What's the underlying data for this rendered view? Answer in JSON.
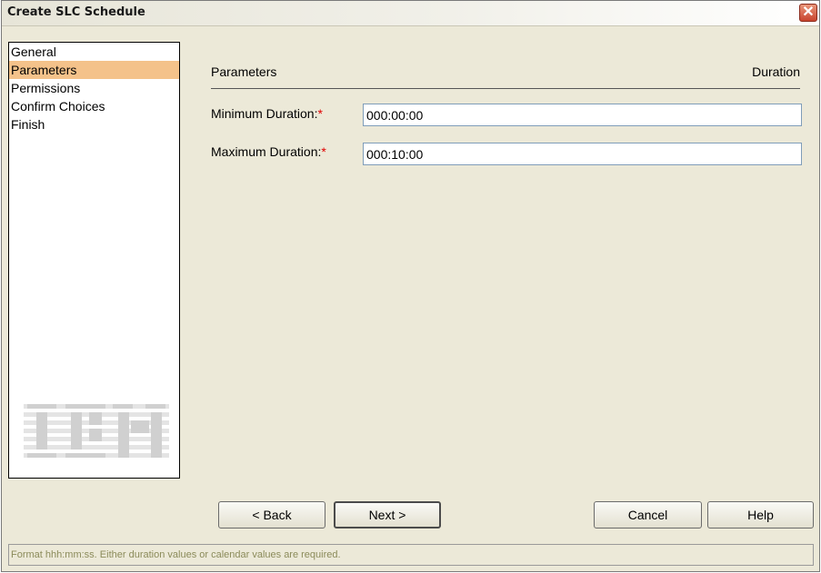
{
  "window": {
    "title": "Create SLC Schedule",
    "close_icon": "close-icon"
  },
  "nav": {
    "items": [
      {
        "label": "General",
        "active": false
      },
      {
        "label": "Parameters",
        "active": true
      },
      {
        "label": "Permissions",
        "active": false
      },
      {
        "label": "Confirm Choices",
        "active": false
      },
      {
        "label": "Finish",
        "active": false
      }
    ],
    "logo": "ibm-logo"
  },
  "section": {
    "title": "Parameters",
    "right_label": "Duration"
  },
  "fields": {
    "min_duration": {
      "label": "Minimum Duration:",
      "required": "*",
      "value": "000:00:00"
    },
    "max_duration": {
      "label": "Maximum Duration:",
      "required": "*",
      "value": "000:10:00"
    }
  },
  "buttons": {
    "back": "< Back",
    "next": "Next >",
    "cancel": "Cancel",
    "help": "Help"
  },
  "status": {
    "text": "Format hhh:mm:ss. Either duration values or calendar values are required."
  },
  "colors": {
    "background": "#ECE9D8",
    "active_nav": "#F4C28A",
    "required": "#E00000",
    "status_text": "#8B8B5A"
  }
}
